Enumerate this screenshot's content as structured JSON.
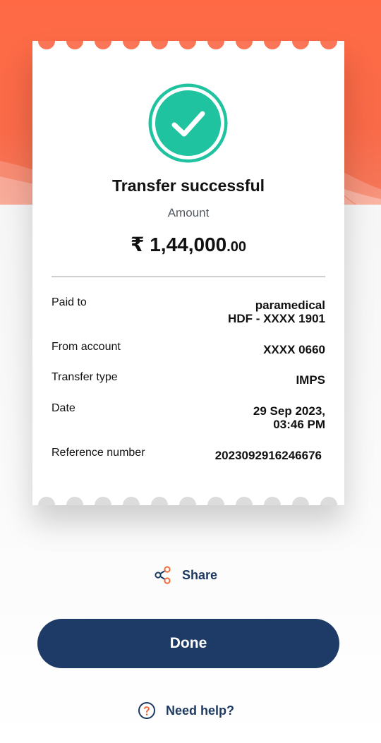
{
  "colors": {
    "brand_orange": "#ff6a45",
    "success_green": "#1fc39f",
    "navy": "#1e3a66",
    "share_icon_accent": "#f26b3a"
  },
  "icons": {
    "success": "check-circle-icon",
    "share": "share-icon",
    "help": "question-circle-icon"
  },
  "receipt": {
    "title": "Transfer successful",
    "amount_label": "Amount",
    "amount_main": "₹ 1,44,000",
    "amount_decimal": ".00",
    "details": {
      "paid_to": {
        "label": "Paid to",
        "value_line1": "paramedical",
        "value_line2": "HDF - XXXX 1901"
      },
      "from_account": {
        "label": "From account",
        "value": "XXXX 0660"
      },
      "transfer_type": {
        "label": "Transfer type",
        "value": "IMPS"
      },
      "date": {
        "label": "Date",
        "value_line1": "29 Sep 2023,",
        "value_line2": "03:46 PM"
      },
      "reference": {
        "label": "Reference number",
        "value": "2023092916246676"
      }
    }
  },
  "actions": {
    "share_label": "Share",
    "done_label": "Done",
    "help_label": "Need help?"
  }
}
